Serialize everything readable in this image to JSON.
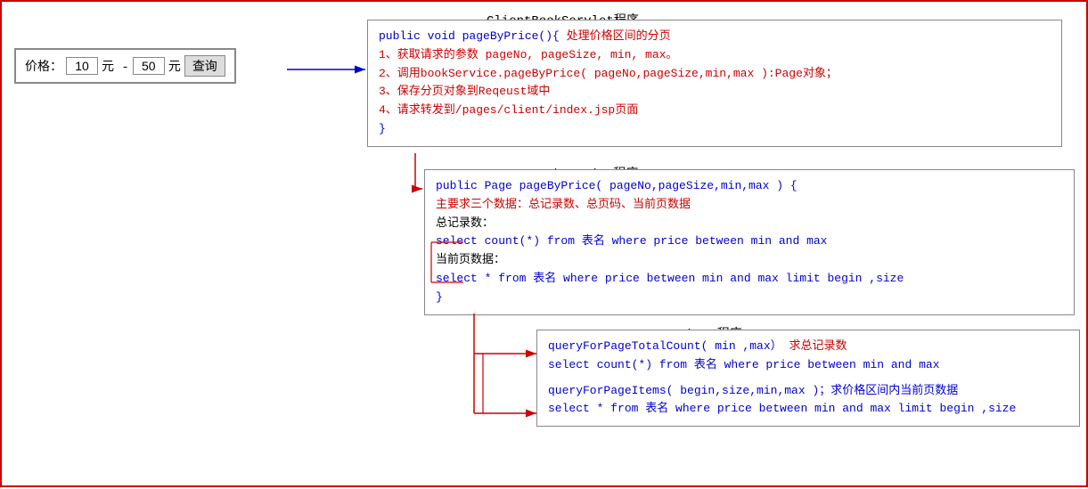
{
  "priceFilter": {
    "label": "价格：",
    "minValue": "10",
    "maxValue": "50",
    "unit1": "元 -",
    "unit2": "元",
    "buttonLabel": "查询"
  },
  "clientServletBox": {
    "title": "ClientBookServlet程序",
    "lines": [
      {
        "type": "mixed",
        "parts": [
          {
            "text": "public void pageByPrice(){",
            "style": "blue"
          },
          {
            "text": "  处理价格区间的分页",
            "style": "red"
          }
        ]
      },
      {
        "type": "mixed",
        "parts": [
          {
            "text": "    1、获取请求的参数 pageNo, pageSize, min, max。",
            "style": "red"
          }
        ]
      },
      {
        "type": "mixed",
        "parts": [
          {
            "text": "    2、调用bookService.pageByPrice( pageNo,pageSize,min,max ):Page对象；",
            "style": "red"
          }
        ]
      },
      {
        "type": "mixed",
        "parts": [
          {
            "text": "    3、保存分页对象到Reqeust域中",
            "style": "red"
          }
        ]
      },
      {
        "type": "mixed",
        "parts": [
          {
            "text": "    4、请求转发到/pages/client/index.jsp页面",
            "style": "red"
          }
        ]
      },
      {
        "type": "mixed",
        "parts": [
          {
            "text": "}",
            "style": "blue"
          }
        ]
      }
    ]
  },
  "bookServiceBox": {
    "title": "BookService程序",
    "lines": [
      {
        "type": "mixed",
        "parts": [
          {
            "text": "public Page pageByPrice( pageNo,pageSize,min,max ) {",
            "style": "blue"
          }
        ]
      },
      {
        "type": "mixed",
        "parts": [
          {
            "text": "    主要求三个数据：总记录数、总页码、当前页数据",
            "style": "red"
          }
        ]
      },
      {
        "type": "mixed",
        "parts": [
          {
            "text": "总记录数：",
            "style": "black"
          }
        ]
      },
      {
        "type": "mixed",
        "parts": [
          {
            "text": "        select count(*) from 表名 where price between min and max",
            "style": "blue"
          }
        ]
      },
      {
        "type": "mixed",
        "parts": [
          {
            "text": "当前页数据：",
            "style": "black"
          }
        ]
      },
      {
        "type": "mixed",
        "parts": [
          {
            "text": "        select * from 表名 where price between min and max limit begin ,size",
            "style": "blue"
          }
        ]
      },
      {
        "type": "mixed",
        "parts": [
          {
            "text": "}",
            "style": "blue"
          }
        ]
      }
    ]
  },
  "bookDaoBox": {
    "title": "BookDao程序",
    "lines": [
      {
        "type": "mixed",
        "parts": [
          {
            "text": "queryForPageTotalCount( min ,max）",
            "style": "blue"
          },
          {
            "text": "  求总记录数",
            "style": "red"
          }
        ]
      },
      {
        "type": "mixed",
        "parts": [
          {
            "text": "    select count(*) from 表名 where price between min and max",
            "style": "blue"
          }
        ]
      },
      {
        "type": "blank"
      },
      {
        "type": "mixed",
        "parts": [
          {
            "text": "queryForPageItems( begin,size,min,max )；求价格区间内当前页数据",
            "style": "blue"
          }
        ]
      },
      {
        "type": "mixed",
        "parts": [
          {
            "text": "    select * from 表名 where price between min and max limit begin ,size",
            "style": "blue"
          }
        ]
      }
    ]
  }
}
